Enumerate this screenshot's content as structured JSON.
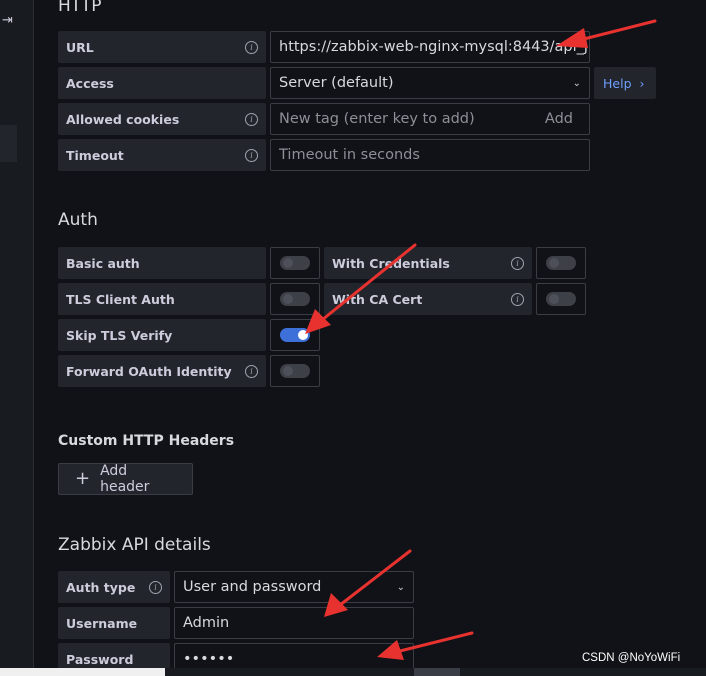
{
  "sidebar": {
    "dock_icon": "dock-panel-icon"
  },
  "http": {
    "title": "HTTP",
    "url": {
      "label": "URL",
      "value": "https://zabbix-web-nginx-mysql:8443/api_j..."
    },
    "access": {
      "label": "Access",
      "value": "Server (default)",
      "help_label": "Help"
    },
    "allowed_cookies": {
      "label": "Allowed cookies",
      "placeholder": "New tag (enter key to add)",
      "add_label": "Add"
    },
    "timeout": {
      "label": "Timeout",
      "placeholder": "Timeout in seconds"
    }
  },
  "auth": {
    "title": "Auth",
    "basic_auth": {
      "label": "Basic auth",
      "enabled": false
    },
    "with_credentials": {
      "label": "With Credentials",
      "enabled": false
    },
    "tls_client_auth": {
      "label": "TLS Client Auth",
      "enabled": false
    },
    "with_ca_cert": {
      "label": "With CA Cert",
      "enabled": false
    },
    "skip_tls_verify": {
      "label": "Skip TLS Verify",
      "enabled": true
    },
    "forward_oauth": {
      "label": "Forward OAuth Identity",
      "enabled": false
    }
  },
  "custom_headers": {
    "title": "Custom HTTP Headers",
    "add_label": "Add header"
  },
  "zabbix": {
    "title": "Zabbix API details",
    "auth_type": {
      "label": "Auth type",
      "value": "User and password"
    },
    "username": {
      "label": "Username",
      "value": "Admin"
    },
    "password": {
      "label": "Password",
      "value": "••••••"
    }
  },
  "watermark": "CSDN @NoYoWiFi",
  "colors": {
    "accent": "#3d71d9",
    "annotation_arrow": "#e8322f",
    "link": "#6e9fff"
  }
}
